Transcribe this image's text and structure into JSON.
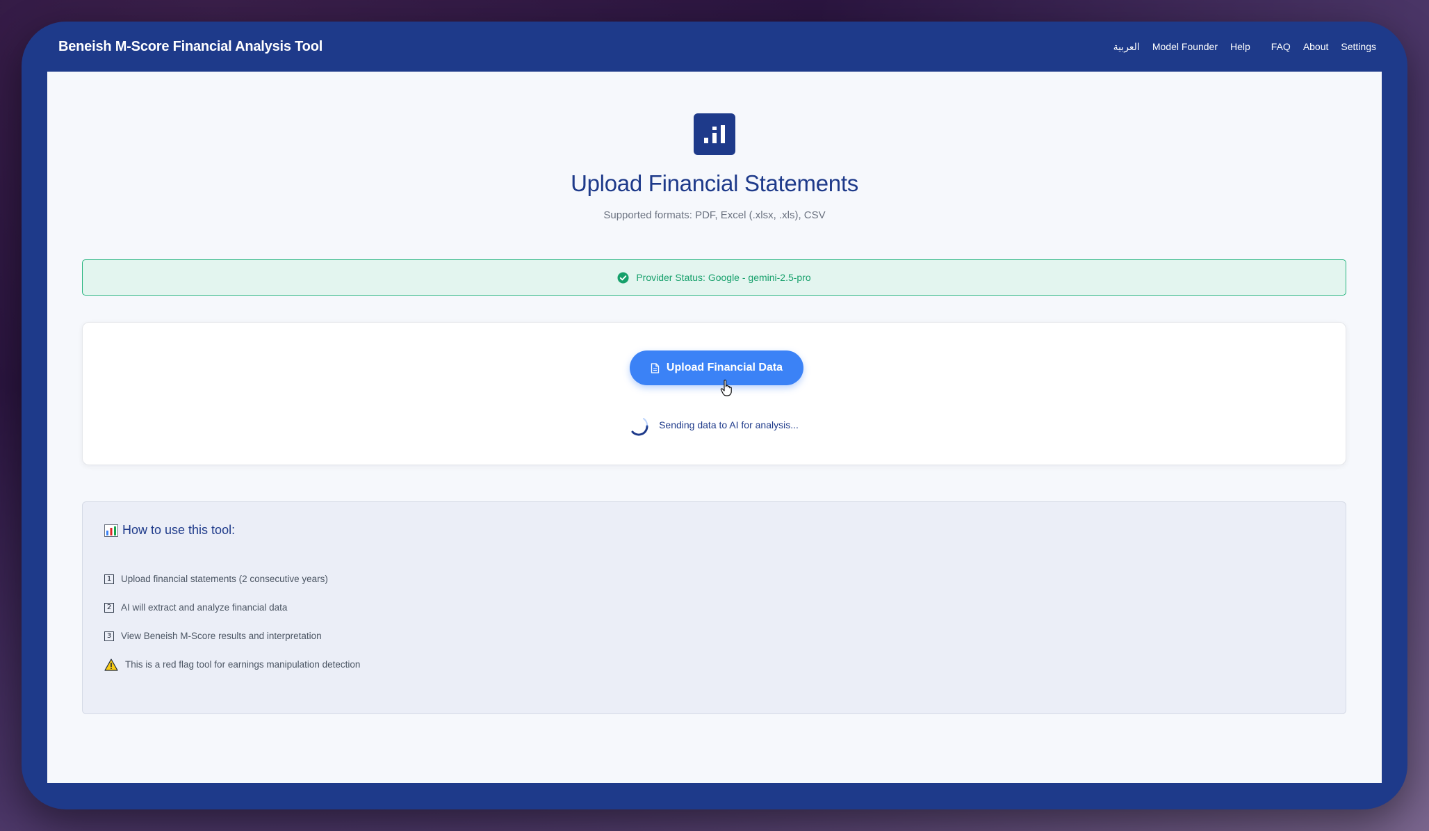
{
  "app": {
    "title": "Beneish M-Score Financial Analysis Tool"
  },
  "nav": {
    "items": [
      {
        "label": "العربية"
      },
      {
        "label": "Model Founder"
      },
      {
        "label": "Help"
      },
      {
        "label": "FAQ"
      },
      {
        "label": "About"
      },
      {
        "label": "Settings"
      }
    ]
  },
  "hero": {
    "icon": "bar-chart-icon",
    "title": "Upload Financial Statements",
    "subtitle": "Supported formats: PDF, Excel (.xlsx, .xls), CSV"
  },
  "status": {
    "icon": "check-circle-icon",
    "text": "Provider Status: Google - gemini-2.5-pro",
    "color": "#16a06b"
  },
  "upload": {
    "button_label": "Upload Financial Data",
    "button_icon": "file-icon",
    "loading_text": "Sending data to AI for analysis..."
  },
  "howto": {
    "icon": "chart-emoji-icon",
    "title": "How to use this tool:",
    "steps": [
      {
        "marker": "1",
        "text": "Upload financial statements (2 consecutive years)"
      },
      {
        "marker": "2",
        "text": "AI will extract and analyze financial data"
      },
      {
        "marker": "3",
        "text": "View Beneish M-Score results and interpretation"
      },
      {
        "marker": "warning",
        "text": "This is a red flag tool for earnings manipulation detection"
      }
    ]
  },
  "colors": {
    "primary": "#1e3a8a",
    "accent": "#3b82f6",
    "success": "#16a06b"
  }
}
